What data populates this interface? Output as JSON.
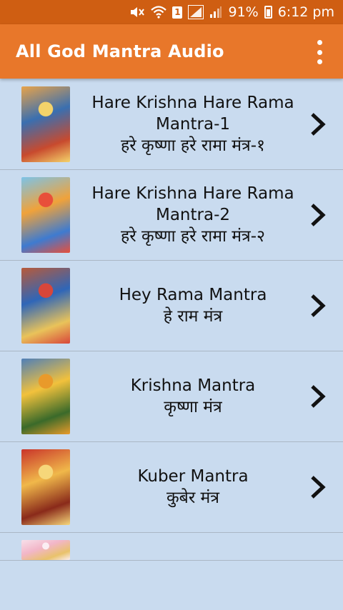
{
  "status_bar": {
    "battery": "91%",
    "time": "6:12 pm",
    "sim": "1",
    "icons": [
      "mute-icon",
      "wifi-icon",
      "sim-icon",
      "signal-icon",
      "signal-icon",
      "battery-icon"
    ]
  },
  "app_bar": {
    "title": "All God Mantra Audio",
    "menu_icon": "overflow-menu-icon"
  },
  "colors": {
    "status_bar": "#cf5e12",
    "app_bar": "#e8772a",
    "list_background": "#c9dbef",
    "divider": "#aab7c5"
  },
  "items": [
    {
      "title_en": "Hare Krishna Hare Rama Mantra-1",
      "title_hi": "हरे कृष्णा हरे रामा मंत्र-१",
      "thumb_colors": [
        "#e8a34a",
        "#3a6fb0",
        "#c84a2e",
        "#f4d36a"
      ]
    },
    {
      "title_en": "Hare Krishna Hare Rama Mantra-2",
      "title_hi": "हरे कृष्णा हरे रामा मंत्र-२",
      "thumb_colors": [
        "#7cc3e8",
        "#f0a23a",
        "#3e7bd0",
        "#e84f3a"
      ]
    },
    {
      "title_en": "Hey Rama Mantra",
      "title_hi": "हे राम मंत्र",
      "thumb_colors": [
        "#b85a3a",
        "#2f66b8",
        "#e9c35a",
        "#d8463a"
      ]
    },
    {
      "title_en": "Krishna Mantra",
      "title_hi": "कृष्णा मंत्र",
      "thumb_colors": [
        "#4f7fb8",
        "#f2c13c",
        "#3a6a2a",
        "#e99a2a"
      ]
    },
    {
      "title_en": "Kuber Mantra",
      "title_hi": "कुबेर मंत्र",
      "thumb_colors": [
        "#c9342a",
        "#f0b84a",
        "#8a2a1a",
        "#f6d77a"
      ]
    }
  ],
  "partial_item": {
    "thumb_colors": [
      "#f7e0ea",
      "#f2b6c8",
      "#e9c26a",
      "#fbeef3"
    ]
  }
}
